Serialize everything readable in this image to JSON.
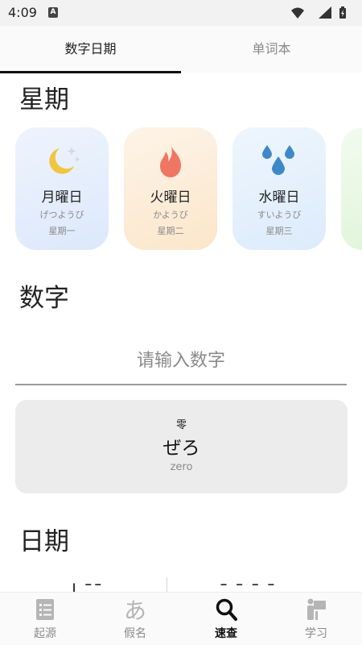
{
  "status_bar": {
    "time": "4:09",
    "notification_letter": "A"
  },
  "tabs": [
    {
      "label": "数字日期",
      "active": true
    },
    {
      "label": "单词本",
      "active": false
    }
  ],
  "weekday_section": {
    "title": "星期",
    "cards": [
      {
        "name": "月曜日",
        "kana": "げつようび",
        "chinese": "星期一",
        "icon": "moon-stars-icon",
        "gradient": [
          "#eef4fd",
          "#dde9fb"
        ]
      },
      {
        "name": "火曜日",
        "kana": "かようび",
        "chinese": "星期二",
        "icon": "fire-icon",
        "gradient": [
          "#fdf4e8",
          "#fbe7cc"
        ]
      },
      {
        "name": "水曜日",
        "kana": "すいようび",
        "chinese": "星期三",
        "icon": "water-drops-icon",
        "gradient": [
          "#eef6fd",
          "#dcecfb"
        ]
      }
    ]
  },
  "number_section": {
    "title": "数字",
    "input_placeholder": "请输入数字",
    "result": {
      "kanji": "零",
      "kana": "ぜろ",
      "romaji": "zero"
    }
  },
  "date_section": {
    "title": "日期"
  },
  "bottom_nav": [
    {
      "label": "起源",
      "icon": "list-doc-icon",
      "active": false
    },
    {
      "label": "假名",
      "icon": "hiragana-a-icon",
      "active": false
    },
    {
      "label": "速查",
      "icon": "search-icon",
      "active": true
    },
    {
      "label": "学习",
      "icon": "study-desk-icon",
      "active": false
    }
  ],
  "colors": {
    "moon": "#f0c540",
    "fire": "#f07664",
    "water": "#3f88c8",
    "active_tab": "#111111",
    "inactive_text": "#8a8a8a"
  }
}
